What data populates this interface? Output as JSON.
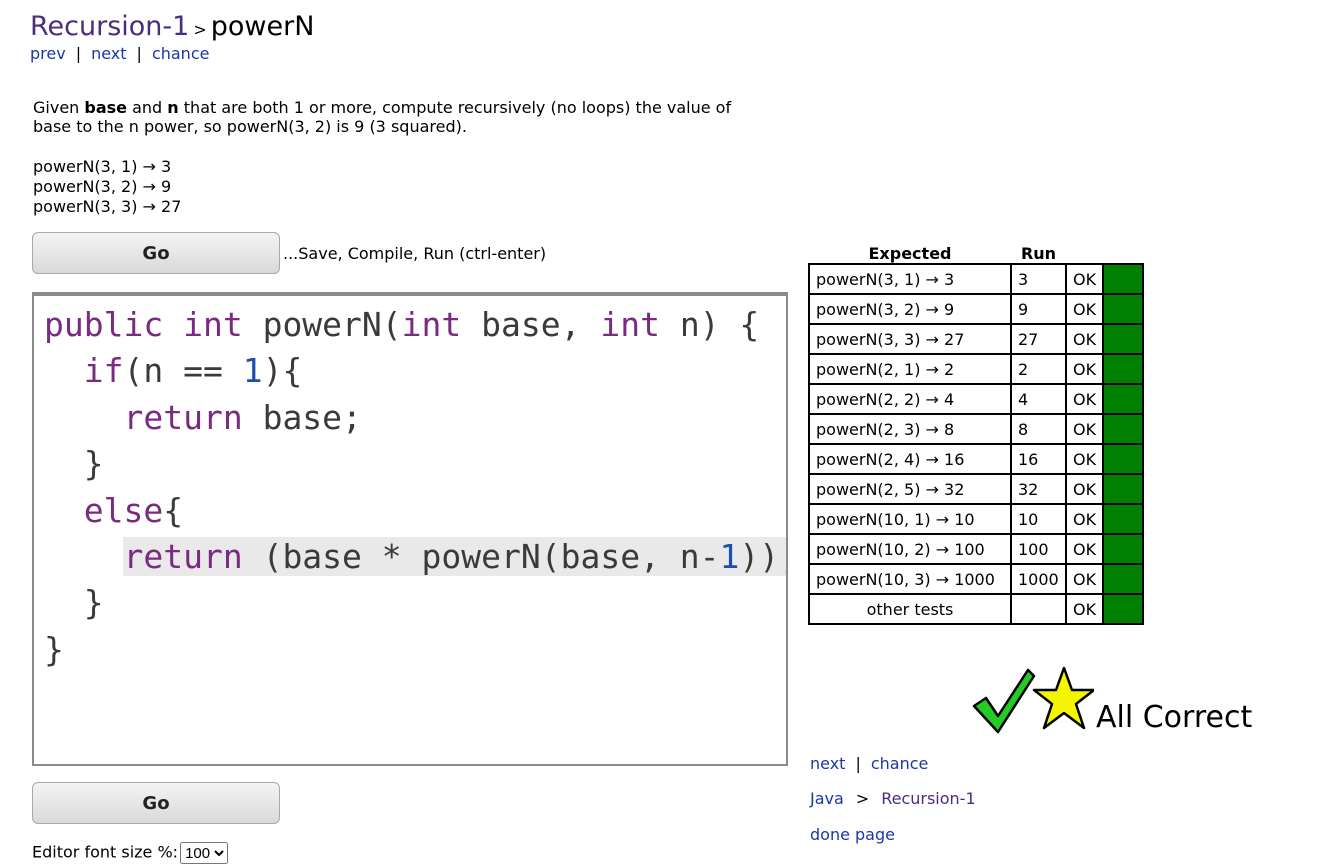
{
  "breadcrumb": {
    "section": "Recursion-1",
    "separator": ">",
    "current": "powerN"
  },
  "nav": {
    "prev": "prev",
    "next": "next",
    "chance": "chance",
    "sep": "|"
  },
  "description": {
    "part1": "Given ",
    "bold1": "base",
    "part2": " and ",
    "bold2": "n",
    "part3": " that are both 1 or more, compute recursively (no loops) the value of base to the n power, so powerN(3, 2) is 9 (3 squared)."
  },
  "examples": [
    "powerN(3, 1) → 3",
    "powerN(3, 2) → 9",
    "powerN(3, 3) → 27"
  ],
  "go_button": "Go",
  "go_hint": "...Save, Compile, Run (ctrl-enter)",
  "code": {
    "l1_kw1": "public",
    "l1_kw2": "int",
    "l1_mid": " powerN(",
    "l1_kw3": "int",
    "l1_mid2": " base, ",
    "l1_kw4": "int",
    "l1_end": " n) {",
    "l2_kw": "if",
    "l2_a": "(n == ",
    "l2_num": "1",
    "l2_b": "){",
    "l3_kw": "return",
    "l3_rest": " base;",
    "l4": "}",
    "l5_kw": "else",
    "l5_rest": "{",
    "l6_kw": "return",
    "l6_a": " (base * powerN(base, n-",
    "l6_num": "1",
    "l6_b": "));",
    "l7": "}",
    "l8": "}"
  },
  "results": {
    "header_expected": "Expected",
    "header_run": "Run",
    "rows": [
      {
        "expected": "powerN(3, 1) → 3",
        "run": "3",
        "status": "OK"
      },
      {
        "expected": "powerN(3, 2) → 9",
        "run": "9",
        "status": "OK"
      },
      {
        "expected": "powerN(3, 3) → 27",
        "run": "27",
        "status": "OK"
      },
      {
        "expected": "powerN(2, 1) → 2",
        "run": "2",
        "status": "OK"
      },
      {
        "expected": "powerN(2, 2) → 4",
        "run": "4",
        "status": "OK"
      },
      {
        "expected": "powerN(2, 3) → 8",
        "run": "8",
        "status": "OK"
      },
      {
        "expected": "powerN(2, 4) → 16",
        "run": "16",
        "status": "OK"
      },
      {
        "expected": "powerN(2, 5) → 32",
        "run": "32",
        "status": "OK"
      },
      {
        "expected": "powerN(10, 1) → 10",
        "run": "10",
        "status": "OK"
      },
      {
        "expected": "powerN(10, 2) → 100",
        "run": "100",
        "status": "OK"
      },
      {
        "expected": "powerN(10, 3) → 1000",
        "run": "1000",
        "status": "OK"
      },
      {
        "expected": "other tests",
        "run": "",
        "status": "OK"
      }
    ],
    "status_color": "#008000"
  },
  "all_correct": "All Correct",
  "icons": {
    "check": "checkmark-icon",
    "star": "star-icon"
  },
  "right_links": {
    "next": "next",
    "chance": "chance",
    "sep": "|",
    "java": "Java",
    "crumb_sep": ">",
    "section": "Recursion-1",
    "done": "done page"
  },
  "font_size": {
    "label": "Editor font size %:",
    "selected": "100"
  }
}
